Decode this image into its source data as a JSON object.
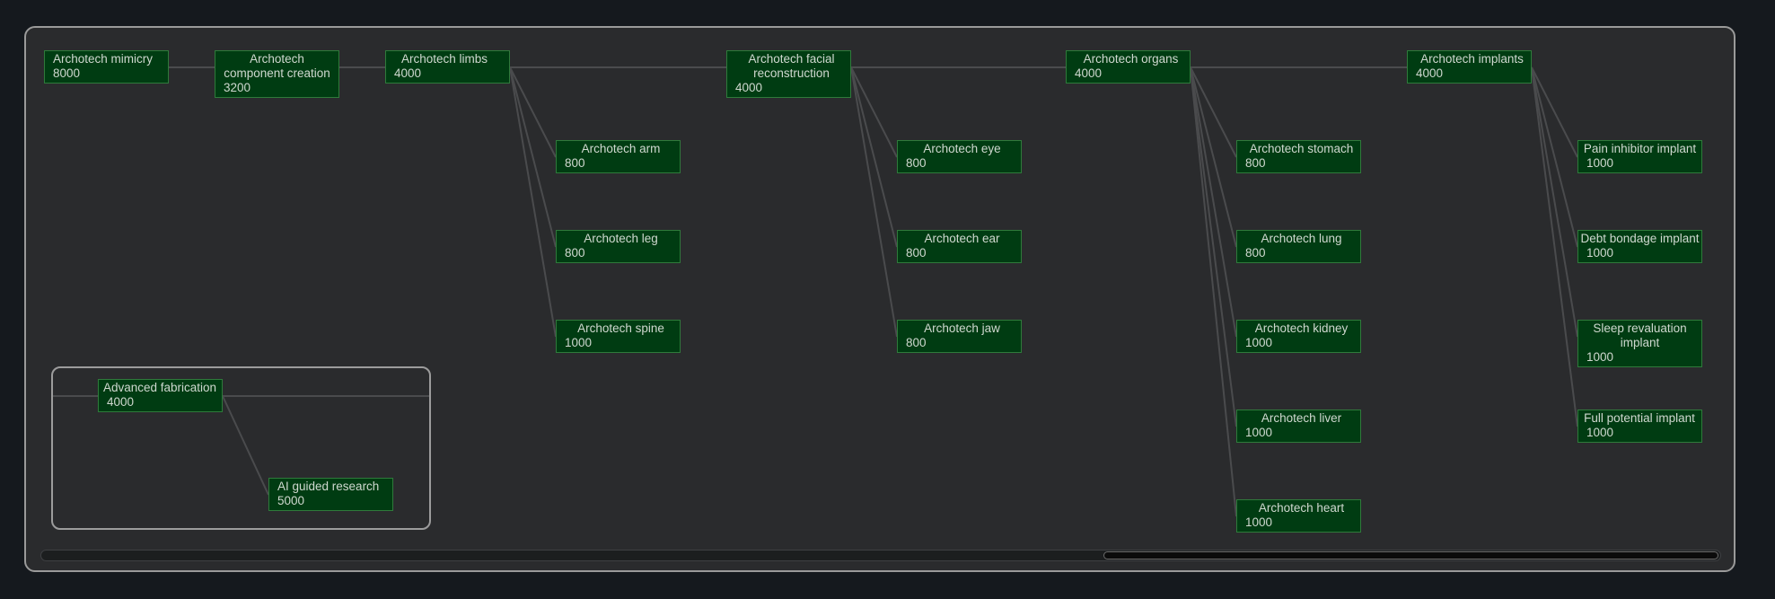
{
  "nodes": [
    {
      "id": "mimicry",
      "name": "Archotech mimicry",
      "cost": "8000"
    },
    {
      "id": "component",
      "name": "Archotech component creation",
      "cost": "3200"
    },
    {
      "id": "limbs",
      "name": "Archotech limbs",
      "cost": "4000"
    },
    {
      "id": "facial",
      "name": "Archotech facial reconstruction",
      "cost": "4000"
    },
    {
      "id": "organs",
      "name": "Archotech organs",
      "cost": "4000"
    },
    {
      "id": "implants",
      "name": "Archotech implants",
      "cost": "4000"
    },
    {
      "id": "arm",
      "name": "Archotech arm",
      "cost": "800"
    },
    {
      "id": "leg",
      "name": "Archotech leg",
      "cost": "800"
    },
    {
      "id": "spine",
      "name": "Archotech spine",
      "cost": "1000"
    },
    {
      "id": "eye",
      "name": "Archotech eye",
      "cost": "800"
    },
    {
      "id": "ear",
      "name": "Archotech ear",
      "cost": "800"
    },
    {
      "id": "jaw",
      "name": "Archotech jaw",
      "cost": "800"
    },
    {
      "id": "stomach",
      "name": "Archotech stomach",
      "cost": "800"
    },
    {
      "id": "lung",
      "name": "Archotech lung",
      "cost": "800"
    },
    {
      "id": "kidney",
      "name": "Archotech kidney",
      "cost": "1000"
    },
    {
      "id": "liver",
      "name": "Archotech liver",
      "cost": "1000"
    },
    {
      "id": "heart",
      "name": "Archotech heart",
      "cost": "1000"
    },
    {
      "id": "pain",
      "name": "Pain inhibitor implant",
      "cost": "1000"
    },
    {
      "id": "debt",
      "name": "Debt bondage implant",
      "cost": "1000"
    },
    {
      "id": "sleep",
      "name": "Sleep revaluation implant",
      "cost": "1000"
    },
    {
      "id": "potential",
      "name": "Full potential implant",
      "cost": "1000"
    },
    {
      "id": "fabrication",
      "name": "Advanced fabrication",
      "cost": "4000"
    },
    {
      "id": "ai",
      "name": "AI guided research",
      "cost": "5000"
    }
  ],
  "links": [
    [
      "mimicry",
      "component"
    ],
    [
      "component",
      "limbs"
    ],
    [
      "limbs",
      "facial"
    ],
    [
      "facial",
      "organs"
    ],
    [
      "organs",
      "implants"
    ],
    [
      "limbs",
      "arm"
    ],
    [
      "limbs",
      "leg"
    ],
    [
      "limbs",
      "spine"
    ],
    [
      "facial",
      "eye"
    ],
    [
      "facial",
      "ear"
    ],
    [
      "facial",
      "jaw"
    ],
    [
      "organs",
      "stomach"
    ],
    [
      "organs",
      "lung"
    ],
    [
      "organs",
      "kidney"
    ],
    [
      "organs",
      "liver"
    ],
    [
      "organs",
      "heart"
    ],
    [
      "implants",
      "pain"
    ],
    [
      "implants",
      "debt"
    ],
    [
      "implants",
      "sleep"
    ],
    [
      "implants",
      "potential"
    ],
    [
      "fabrication",
      "ai"
    ]
  ],
  "colors": {
    "node_fill": "#003c12",
    "node_border": "#2f7a3b",
    "node_text": "#cfd8cf",
    "link": "#4a4b4d",
    "panel": "#2a2b2d",
    "background": "#15191e"
  }
}
